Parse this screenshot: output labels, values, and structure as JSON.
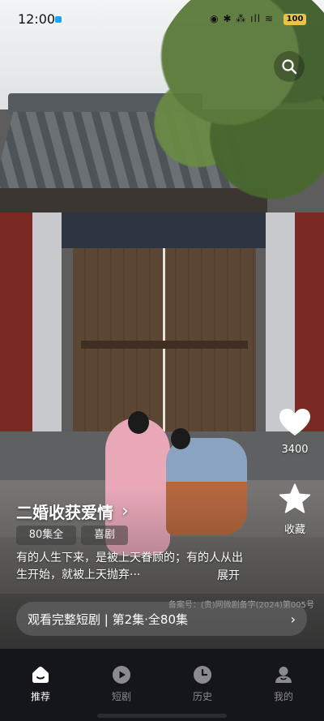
{
  "status_bar": {
    "time": "12:00",
    "icons": "◉ ✱ ⁂ ıll ≋",
    "battery": "100"
  },
  "search": {
    "icon": "search-icon"
  },
  "actions": {
    "like_count": "3400",
    "favorite_label": "收藏"
  },
  "drama": {
    "title": "二婚收获爱情",
    "title_arrow": "›",
    "tags": [
      "80集全",
      "喜剧"
    ],
    "synopsis": "有的人生下来，是被上天眷顾的；有的人从出生开始，就被上天抛弃···",
    "expand_label": "展开",
    "license": "备案号：(贵)网微剧备字(2024)第005号"
  },
  "watch_bar": {
    "label": "观看完整短剧 | 第2集·全80集",
    "arrow": "›"
  },
  "nav": {
    "items": [
      {
        "label": "推荐",
        "icon": "home-icon",
        "active": true
      },
      {
        "label": "短剧",
        "icon": "play-icon",
        "active": false
      },
      {
        "label": "历史",
        "icon": "clock-icon",
        "active": false
      },
      {
        "label": "我的",
        "icon": "user-icon",
        "active": false
      }
    ]
  },
  "colors": {
    "nav_background": "#15151c",
    "nav_active": "#ffffff",
    "nav_inactive": "#8a8a90",
    "battery": "#e8c24a"
  }
}
